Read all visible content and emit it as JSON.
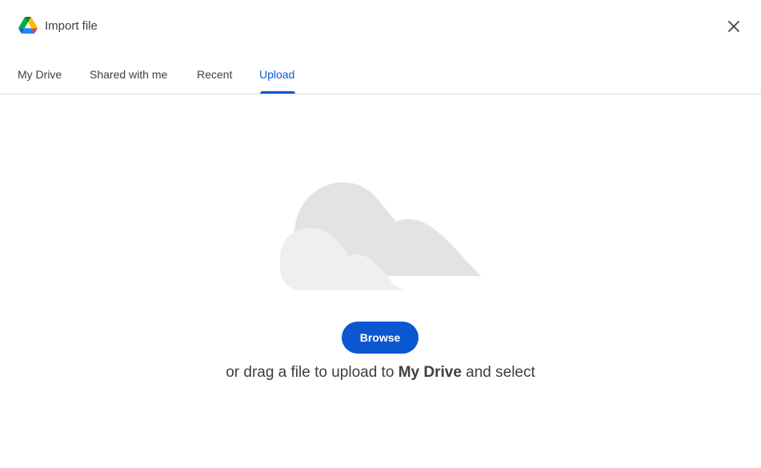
{
  "header": {
    "title": "Import file",
    "logo_icon": "google-drive-icon",
    "close_icon": "close-icon"
  },
  "tabs": [
    {
      "label": "My Drive",
      "active": false
    },
    {
      "label": "Shared with me",
      "active": false
    },
    {
      "label": "Recent",
      "active": false
    },
    {
      "label": "Upload",
      "active": true
    }
  ],
  "upload": {
    "illustration_icon": "cloud-illustration",
    "browse_label": "Browse",
    "drag_prefix": "or drag a file to upload to ",
    "drag_location": "My Drive",
    "drag_suffix": " and select"
  },
  "colors": {
    "accent": "#0b57d0",
    "text": "#3c4043",
    "divider": "#dadce0",
    "cloud_back": "#e3e3e6",
    "cloud_front": "#efeff1"
  }
}
